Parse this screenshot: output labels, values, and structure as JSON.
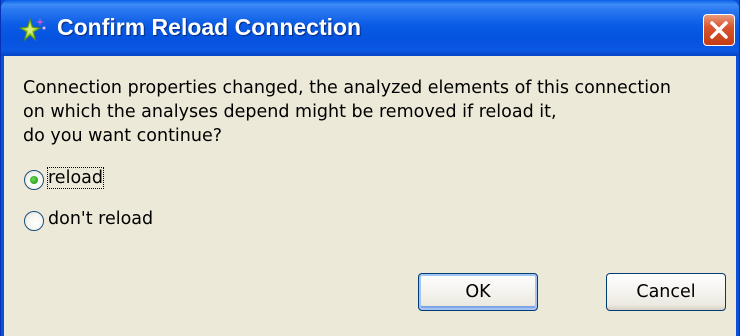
{
  "window": {
    "title": "Confirm Reload Connection",
    "icon": "sparkle-star-icon",
    "close_icon": "close-icon"
  },
  "message": {
    "lines": [
      "Connection properties changed, the analyzed elements of this connection",
      "on which the analyses depend might be removed if reload it,",
      "do you want continue?"
    ]
  },
  "options": [
    {
      "label": "reload",
      "selected": true
    },
    {
      "label": "don't reload",
      "selected": false
    }
  ],
  "buttons": {
    "ok_label": "OK",
    "cancel_label": "Cancel"
  },
  "colors": {
    "titlebar": "#0a5be6",
    "close_button": "#d9552e",
    "dialog_background": "#ece9d8",
    "radio_selected": "#2ca11e"
  }
}
